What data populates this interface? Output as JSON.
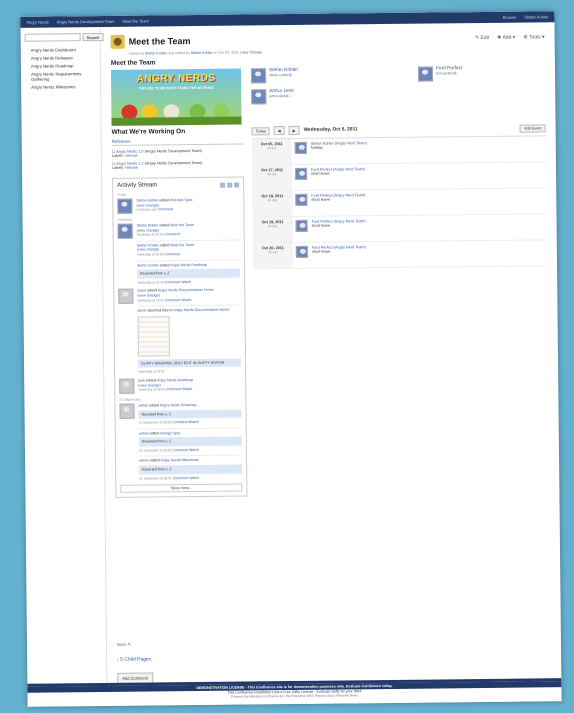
{
  "topbar": {
    "left_items": [
      "Angry Nerds",
      "Angry Nerds Development Team",
      "Meet the Team"
    ],
    "right_items": [
      "Browse",
      "Stefan Kohler"
    ]
  },
  "sidebar": {
    "search_button": "Search",
    "items": [
      "Angry Nerds Dashboard",
      "Angry Nerds Releases",
      "Angry Nerds Roadmap",
      "Angry Nerds Requirements Gathering",
      "Angry Nerds Milestones"
    ]
  },
  "page": {
    "title": "Meet the Team",
    "actions": {
      "edit": "Edit",
      "add": "Add",
      "tools": "Tools"
    },
    "byline": {
      "prefix": "Added by",
      "author": "Stefan Kohler",
      "edited": "last edited by",
      "editor": "Stefan Kohler",
      "date": "on Oct 04, 2011",
      "view_change": "view change"
    },
    "heading": "Meet the Team",
    "working_on": "What We're Working On"
  },
  "banner": {
    "title": "ANGRY NERDS",
    "tagline": "THIS DEV TEAM DON'T STAND FOR NO BUGS"
  },
  "team": [
    {
      "name": "Stefan Kohler",
      "email": "stefan.kohler@..."
    },
    {
      "name": "Ford Perfect",
      "email": "ford.perfect@..."
    },
    {
      "name": "Arthur Dent",
      "email": "arthur.dent@..."
    }
  ],
  "releases": {
    "header": "Releases",
    "items": [
      {
        "link": "Angry Nerds 1.0",
        "team": "(Angry Nerds Development Team)",
        "labels_prefix": "Labels:",
        "label": "release"
      },
      {
        "link": "Angry Nerds 1.1",
        "team": "(Angry Nerds Development Team)",
        "labels_prefix": "Labels:",
        "label": "release"
      }
    ]
  },
  "activity": {
    "title": "Activity Stream",
    "today": "Today",
    "yesterday": "Yesterday",
    "sep21": "21 September",
    "show_more": "Show more...",
    "e1": {
      "user": "Stefan Kohler",
      "verb": "edited",
      "target": "Pod App Spec",
      "view": "(view change)",
      "time": "3 minutes ago",
      "comment": "Comment"
    },
    "e2": {
      "user": "Stefan Kohler",
      "verb": "edited",
      "target": "Meet the Team",
      "view": "(view change)",
      "time": "Yesterday at 20:15",
      "comment": "Comment"
    },
    "e2b": {
      "user": "Stefan Kohler",
      "verb": "edited",
      "target": "Meet the Team",
      "view": "(view change)",
      "time": "Yesterday at 20:09",
      "comment": "Comment"
    },
    "e2c": {
      "user": "Stefan Kohler",
      "verb": "edited",
      "target": "Angry Nerds Roadmap",
      "diff": "Reverted from v. 2",
      "time": "Yesterday at 01:28",
      "comment": "Comment",
      "watch": "Watch"
    },
    "e3": {
      "user": "sarah",
      "verb": "edited",
      "target": "Angry Nerds Documentation Home",
      "view": "(view change)",
      "time": "Yesterday at 18:02",
      "comment": "Comment",
      "watch": "Watch"
    },
    "e3b": {
      "user": "sarah",
      "verb": "attached files to",
      "target": "Angry Nerds Documentation Home",
      "note": "GLIFFY DIAGRAM, ONLY EDIT IN GLIFFY EDITOR",
      "time": "Yesterday at 18:02"
    },
    "e4": {
      "user": "jane",
      "verb": "edited",
      "target": "Angry Nerds Roadmap",
      "view": "(view change)",
      "time": "Yesterday at 09:04",
      "comment": "Comment",
      "watch": "Watch"
    },
    "e5": {
      "user": "admin",
      "verb": "edited",
      "target": "Angry Nerds Roadmap",
      "diff": "Reverted from v. 2",
      "time": "21 September at 08:33",
      "comment": "Comment",
      "watch": "Watch"
    },
    "e5b": {
      "user": "admin",
      "verb": "edited",
      "target": "Beings Spec",
      "diff": "Reverted from v. 2",
      "time": "21 September at 08:32",
      "comment": "Comment",
      "watch": "Watch"
    },
    "e5c": {
      "user": "admin",
      "verb": "edited",
      "target": "Angry Nerds Milestones",
      "diff": "Reverted from v. 2",
      "time": "21 September at 08:31",
      "comment": "Comment",
      "watch": "Watch"
    }
  },
  "calendar": {
    "today_btn": "Today",
    "prev": "◀",
    "next": "▶",
    "date": "Wednesday, Oct 5, 2011",
    "add_event": "Add Event",
    "rows": [
      {
        "date": "Oct 05, 2011",
        "rel": "All day",
        "who": "Stefan Kohler",
        "team": "(Angry Nerd Team)",
        "what": "holiday"
      },
      {
        "date": "Oct 17, 2011",
        "rel": "All day",
        "who": "Ford Perfect",
        "team": "(Angry Nerd Team)",
        "what": "short leave"
      },
      {
        "date": "Oct 18, 2011",
        "rel": "All day",
        "who": "Ford Perfect",
        "team": "(Angry Nerd Team)",
        "what": "short leave"
      },
      {
        "date": "Oct 19, 2011",
        "rel": "All day",
        "who": "Ford Perfect",
        "team": "(Angry Nerd Team)",
        "what": "short leave"
      },
      {
        "date": "Oct 20, 2011",
        "rel": "All day",
        "who": "Ford Perfect",
        "team": "(Angry Nerd Team)",
        "what": "short leave"
      }
    ]
  },
  "footer": {
    "labels": "None",
    "child_pages": "5 Child Pages",
    "add_comment": "Add Comment",
    "license": "DEMONSTRATION LICENSE - This Confluence site is for demonstration purposes only. Evaluate Confluence today.",
    "gliffy": "This Confluence installation runs a Free Gliffy License - Evaluate Gliffy for your Wiki!",
    "powered": "Powered by Atlassian Confluence 4.0, the Enterprise Wiki | Report a bug | Atlassian News"
  }
}
